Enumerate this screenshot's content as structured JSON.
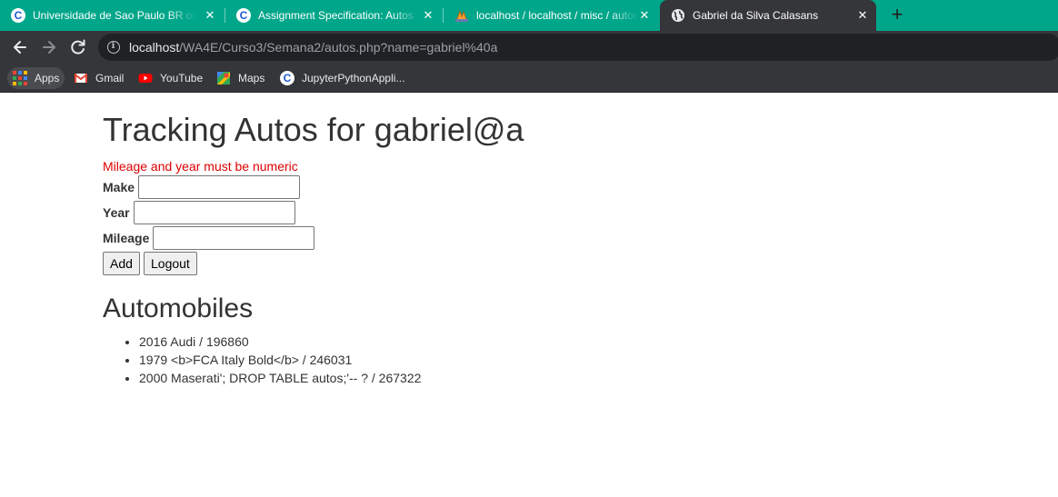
{
  "colors": {
    "tab_strip": "#00a68a",
    "toolbar": "#35363a",
    "error_text": "#dd0000",
    "page_text": "#333333"
  },
  "tabs": [
    {
      "title": "Universidade de Sao Paulo BR on",
      "icon": "coursera-icon",
      "active": false
    },
    {
      "title": "Assignment Specification: Autos",
      "icon": "coursera-icon",
      "active": false
    },
    {
      "title": "localhost / localhost / misc / autos",
      "icon": "phpmyadmin-icon",
      "active": false
    },
    {
      "title": "Gabriel da Silva Calasans",
      "icon": "globe-icon",
      "active": true
    }
  ],
  "toolbar": {
    "url_host": "localhost",
    "url_path": "/WA4E/Curso3/Semana2/autos.php?name=gabriel%40a"
  },
  "bookmarks": [
    {
      "label": "Apps",
      "icon": "apps-grid-icon"
    },
    {
      "label": "Gmail",
      "icon": "gmail-icon"
    },
    {
      "label": "YouTube",
      "icon": "youtube-icon"
    },
    {
      "label": "Maps",
      "icon": "maps-icon"
    },
    {
      "label": "JupyterPythonAppli...",
      "icon": "coursera-icon"
    }
  ],
  "page": {
    "title": "Tracking Autos for gabriel@a",
    "error": "Mileage and year must be numeric",
    "form": {
      "make_label": "Make",
      "make_value": "",
      "year_label": "Year",
      "year_value": "",
      "mileage_label": "Mileage",
      "mileage_value": "",
      "add_label": "Add",
      "logout_label": "Logout"
    },
    "automobiles_heading": "Automobiles",
    "automobiles": [
      "2016 Audi / 196860",
      "1979 <b>FCA Italy Bold</b> / 246031",
      "2000 Maserati'; DROP TABLE autos;'-- ? / 267322"
    ]
  }
}
